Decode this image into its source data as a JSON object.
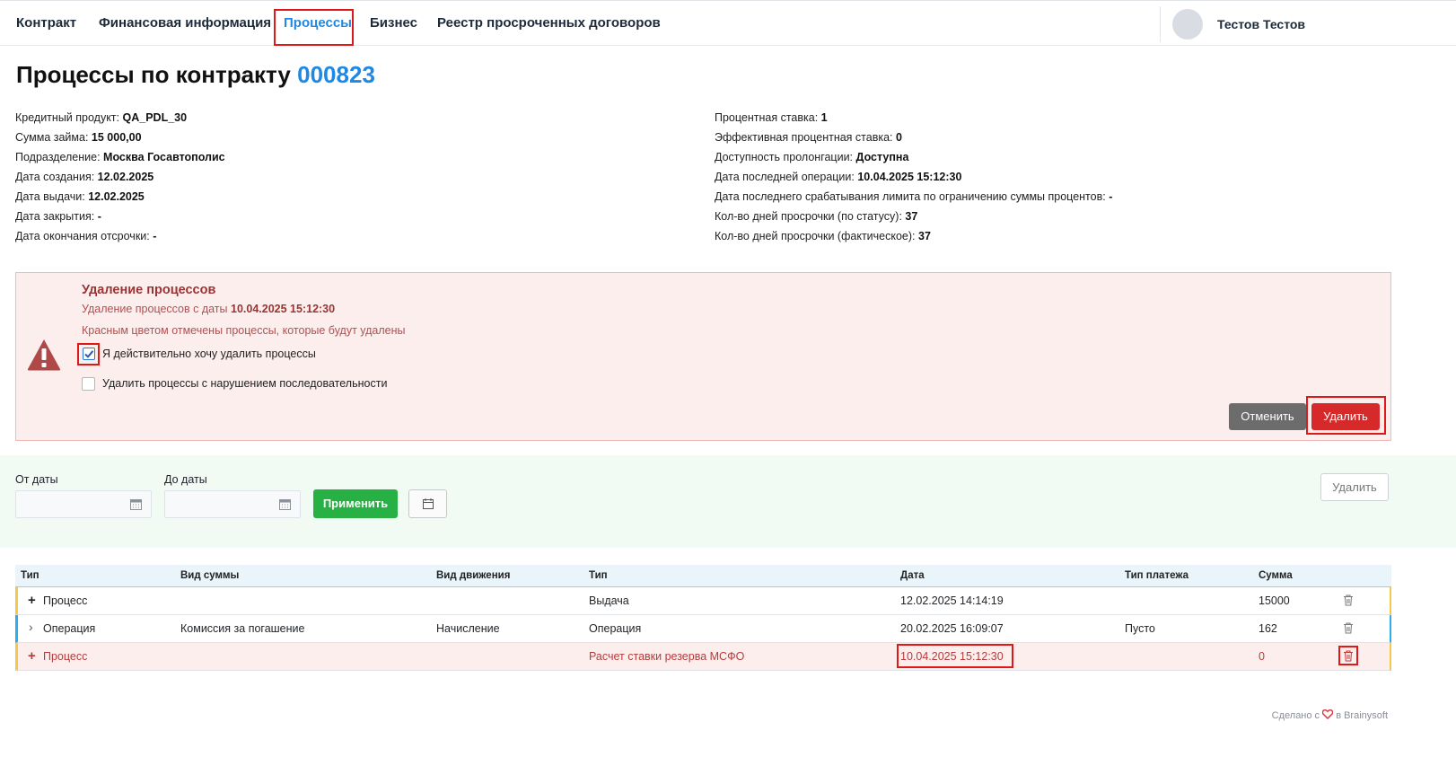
{
  "nav": {
    "tabs": [
      {
        "label": "Контракт"
      },
      {
        "label": "Финансовая информация"
      },
      {
        "label": "Процессы"
      },
      {
        "label": "Бизнес"
      },
      {
        "label": "Реестр просроченных договоров"
      }
    ],
    "user_name": "Тестов Тестов"
  },
  "page": {
    "title_prefix": "Процессы по контракту",
    "contract_number": "000823"
  },
  "info_left": [
    {
      "label": "Кредитный продукт:",
      "value": "QA_PDL_30"
    },
    {
      "label": "Сумма займа:",
      "value": "15 000,00"
    },
    {
      "label": "Подразделение:",
      "value": "Москва Госавтополис"
    },
    {
      "label": "Дата создания:",
      "value": "12.02.2025"
    },
    {
      "label": "Дата выдачи:",
      "value": "12.02.2025"
    },
    {
      "label": "Дата закрытия:",
      "value": "-"
    },
    {
      "label": "Дата окончания отсрочки:",
      "value": "-"
    }
  ],
  "info_right": [
    {
      "label": "Процентная ставка:",
      "value": "1"
    },
    {
      "label": "Эффективная процентная ставка:",
      "value": "0"
    },
    {
      "label": "Доступность пролонгации:",
      "value": "Доступна"
    },
    {
      "label": "Дата последней операции:",
      "value": "10.04.2025 15:12:30"
    },
    {
      "label": "Дата последнего срабатывания лимита по ограничению суммы процентов:",
      "value": "-"
    },
    {
      "label": "Кол-во дней просрочки (по статусу):",
      "value": "37"
    },
    {
      "label": "Кол-во дней просрочки (фактическое):",
      "value": "37"
    }
  ],
  "alert": {
    "title": "Удаление процессов",
    "subtitle_prefix": "Удаление процессов с даты",
    "subtitle_date": "10.04.2025 15:12:30",
    "note": "Красным цветом отмечены процессы, которые будут удалены",
    "confirm_label": "Я действительно хочу удалить процессы",
    "confirm_checked": true,
    "sequence_label": "Удалить процессы с нарушением последовательности",
    "sequence_checked": false,
    "cancel_label": "Отменить",
    "delete_label": "Удалить",
    "colors": {
      "danger": "#d62a2a",
      "text": "#9a3434",
      "background": "#fdeeee"
    }
  },
  "filter": {
    "from_label": "От даты",
    "to_label": "До даты",
    "from_value": "",
    "to_value": "",
    "apply_label": "Применить",
    "delete_label": "Удалить",
    "colors": {
      "apply": "#27b043"
    }
  },
  "table": {
    "headers": [
      "Тип",
      "Вид суммы",
      "Вид движения",
      "Тип",
      "Дата",
      "Тип платежа",
      "Сумма"
    ],
    "rows": [
      {
        "expander": "+",
        "type": "Процесс",
        "sum_kind": "",
        "movement": "",
        "type2": "Выдача",
        "date": "12.02.2025 14:14:19",
        "payment_type": "",
        "amount": "15000",
        "marked": false
      },
      {
        "expander": "›",
        "type": "Операция",
        "sum_kind": "Комиссия за погашение",
        "movement": "Начисление",
        "type2": "Операция",
        "date": "20.02.2025 16:09:07",
        "payment_type": "Пусто",
        "amount": "162",
        "marked": false
      },
      {
        "expander": "+",
        "type": "Процесс",
        "sum_kind": "",
        "movement": "",
        "type2": "Расчет ставки резерва МСФО",
        "date": "10.04.2025 15:12:30",
        "payment_type": "",
        "amount": "0",
        "marked": true
      }
    ]
  },
  "footer": {
    "prefix": "Сделано с",
    "suffix": "в Brainysoft"
  },
  "icons": [
    "warning-triangle-icon",
    "calendar-icon",
    "trash-icon",
    "heart-icon",
    "checkmark-icon",
    "plus-icon",
    "chevron-right-icon"
  ]
}
